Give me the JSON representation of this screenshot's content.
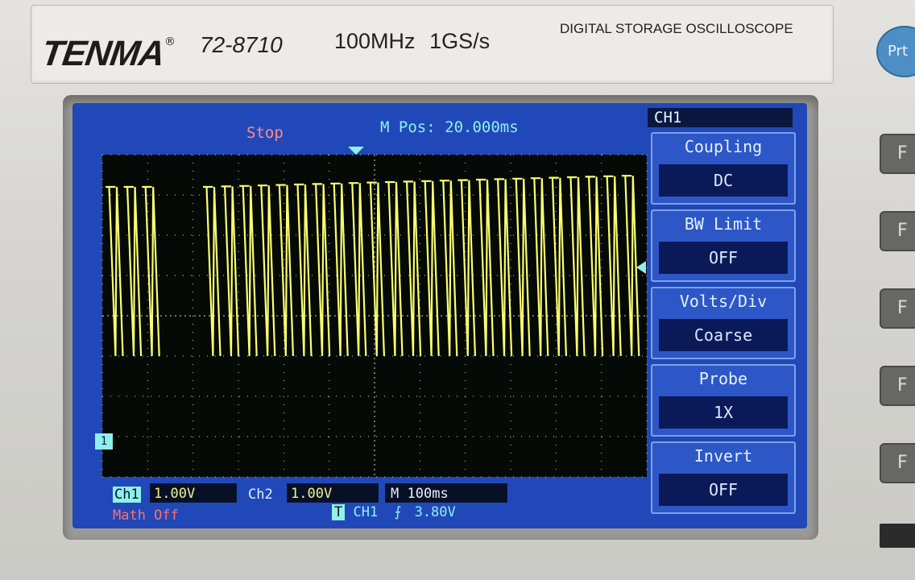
{
  "device": {
    "brand": "TENMA",
    "registered_mark": "®",
    "model": "72-8710",
    "bandwidth": "100MHz",
    "sample_rate": "1GS/s",
    "subtitle": "DIGITAL STORAGE OSCILLOSCOPE",
    "print_button_label": "Prt",
    "side_button_glyph": "F"
  },
  "status": {
    "run_state": "Stop",
    "marker_glyph": "M",
    "position_label": "Pos:",
    "position_value": "20.000ms"
  },
  "bottom_bar": {
    "ch1_label": "Ch1",
    "ch1_scale": "1.00V",
    "ch2_label": "Ch2",
    "ch2_scale": "1.00V",
    "timebase_label": "M",
    "timebase_value": "100ms",
    "math_status": "Math Off",
    "trigger_glyph": "T",
    "trigger_source": "CH1",
    "trigger_edge_glyph": "⨍",
    "trigger_level": "3.80V"
  },
  "menu": {
    "title": "CH1",
    "items": [
      {
        "label": "Coupling",
        "value": "DC"
      },
      {
        "label": "BW Limit",
        "value": "OFF"
      },
      {
        "label": "Volts/Div",
        "value": "Coarse"
      },
      {
        "label": "Probe",
        "value": "1X"
      },
      {
        "label": "Invert",
        "value": "OFF"
      }
    ]
  },
  "ground_marker": "1",
  "colors": {
    "lcd_background": "#2148b8",
    "grid_area": "#050a06",
    "trace": "#fbff6e",
    "accent_cyan": "#8ff0ea",
    "stop_red": "#ff8a8a"
  },
  "waveform": {
    "description": "digital pulse train, high level near top, fast falling edges with slow ramp-down segments",
    "high_level_div": 3.2,
    "low_level_div": -1.0,
    "pulse_count_first_burst": 3,
    "pulse_count_second_burst": 24
  }
}
